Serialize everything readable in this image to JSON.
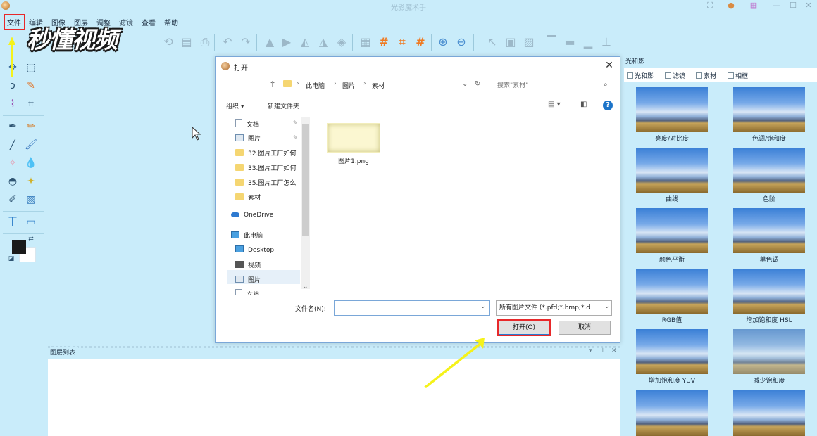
{
  "window": {
    "title": "光影魔术手"
  },
  "menubar": {
    "items": [
      "文件",
      "编辑",
      "图像",
      "图层",
      "调整",
      "滤镜",
      "查看",
      "帮助"
    ]
  },
  "watermark": {
    "text": "秒懂视频"
  },
  "layers_panel": {
    "title": "图层列表"
  },
  "right_panel": {
    "title": "光和影",
    "tabs": [
      "光和影",
      "滤镜",
      "素材",
      "相框"
    ],
    "effects": [
      "亮度/对比度",
      "色调/饱和度",
      "曲线",
      "色阶",
      "颜色平衡",
      "单色调",
      "RGB值",
      "增加饱和度 HSL",
      "增加饱和度 YUV",
      "减少饱和度"
    ]
  },
  "dialog": {
    "title": "打开",
    "breadcrumb": [
      "此电脑",
      "图片",
      "素材"
    ],
    "search_placeholder": "搜索\"素材\"",
    "commands": {
      "organize": "组织 ▾",
      "new_folder": "新建文件夹"
    },
    "help": "?",
    "nav_items": [
      {
        "label": "文档",
        "icon": "document-icon"
      },
      {
        "label": "图片",
        "icon": "picture-icon"
      },
      {
        "label": "32.图片工厂如何",
        "icon": "folder-icon"
      },
      {
        "label": "33.图片工厂如何",
        "icon": "folder-icon"
      },
      {
        "label": "35.图片工厂怎么",
        "icon": "folder-icon"
      },
      {
        "label": "素材",
        "icon": "folder-icon"
      },
      {
        "label": "OneDrive",
        "icon": "cloud-icon"
      },
      {
        "label": "此电脑",
        "icon": "computer-icon"
      },
      {
        "label": "Desktop",
        "icon": "desktop-icon"
      },
      {
        "label": "视频",
        "icon": "video-icon"
      },
      {
        "label": "图片",
        "icon": "picture-icon"
      },
      {
        "label": "文档",
        "icon": "document-icon"
      }
    ],
    "files": [
      {
        "name": "图片1.png"
      }
    ],
    "filename_label": "文件名(N):",
    "filename_value": "",
    "filetype": "所有图片文件 (*.pfd;*.bmp;*.d",
    "open_button": "打开(O)",
    "cancel_button": "取消"
  },
  "accent": {
    "highlight_red": "#e8282a",
    "arrow_yellow": "#f5f21a",
    "app_bg": "#c9ecfa"
  }
}
